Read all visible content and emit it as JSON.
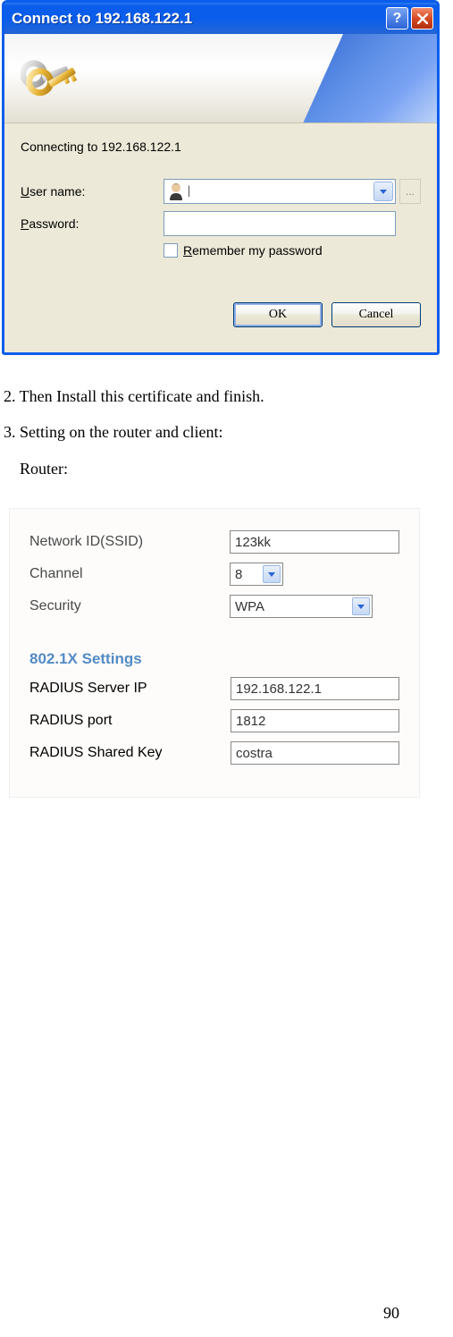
{
  "dialog": {
    "title": "Connect to 192.168.122.1",
    "connecting": "Connecting to 192.168.122.1",
    "username_label_pre": "U",
    "username_label_post": "ser name:",
    "password_label_pre": "P",
    "password_label_post": "assword:",
    "password_value": "",
    "remember_pre": "R",
    "remember_post": "emember my password",
    "ok": "OK",
    "cancel": "Cancel"
  },
  "instructions": {
    "step2": "2. Then Install this certificate and finish.",
    "step3": "3. Setting on the router and client:",
    "router": "Router:"
  },
  "router": {
    "ssid_label": "Network ID(SSID)",
    "ssid_value": "123kk",
    "channel_label": "Channel",
    "channel_value": "8",
    "security_label": "Security",
    "security_value": "WPA",
    "section_title": "802.1X Settings",
    "radius_ip_label": "RADIUS Server IP",
    "radius_ip_value": "192.168.122.1",
    "radius_port_label": "RADIUS port",
    "radius_port_value": "1812",
    "radius_key_label": "RADIUS Shared Key",
    "radius_key_value": "costra"
  },
  "page_number": "90"
}
